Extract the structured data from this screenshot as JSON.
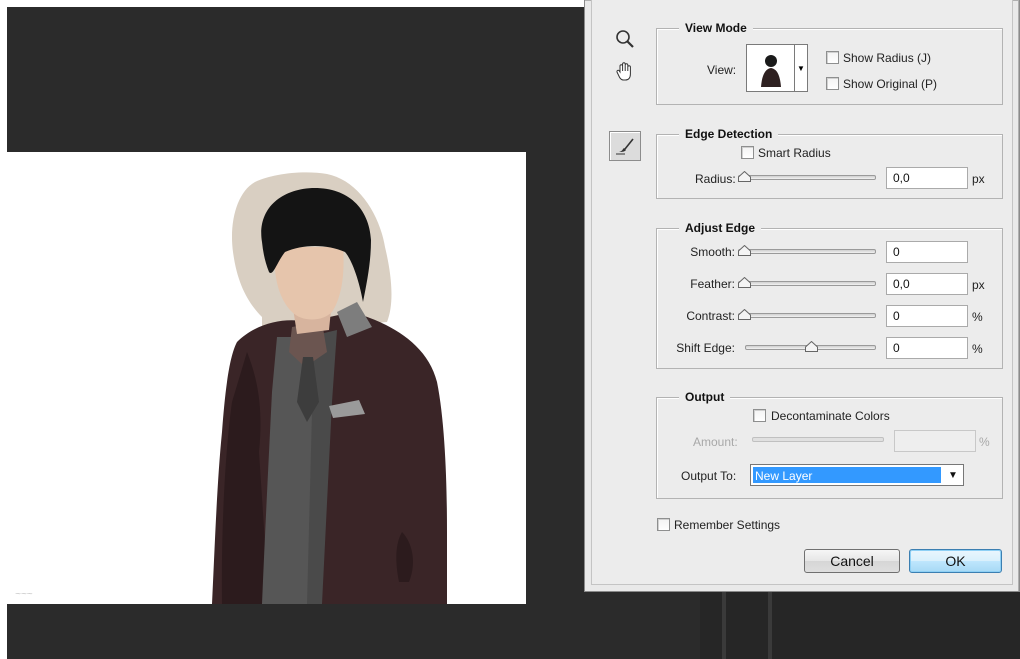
{
  "dialog": {
    "tools": [
      "zoom-tool",
      "hand-tool",
      "refine-radius-tool"
    ],
    "view_mode": {
      "title": "View Mode",
      "view_label": "View:",
      "show_radius": "Show Radius (J)",
      "show_original": "Show Original (P)"
    },
    "edge_detection": {
      "title": "Edge Detection",
      "smart_radius": "Smart Radius",
      "radius_label": "Radius:",
      "radius_value": "0,0",
      "radius_unit": "px"
    },
    "adjust_edge": {
      "title": "Adjust Edge",
      "smooth_label": "Smooth:",
      "smooth_value": "0",
      "feather_label": "Feather:",
      "feather_value": "0,0",
      "feather_unit": "px",
      "contrast_label": "Contrast:",
      "contrast_value": "0",
      "contrast_unit": "%",
      "shift_label": "Shift Edge:",
      "shift_value": "0",
      "shift_unit": "%"
    },
    "output": {
      "title": "Output",
      "decontaminate": "Decontaminate Colors",
      "amount_label": "Amount:",
      "amount_value": "",
      "amount_unit": "%",
      "output_to_label": "Output To:",
      "output_to_value": "New Layer"
    },
    "remember_settings": "Remember Settings",
    "cancel_label": "Cancel",
    "ok_label": "OK"
  },
  "colors": {
    "workspace": "#2b2b2b",
    "dialog_bg": "#ececec",
    "selection": "#3399ff"
  }
}
